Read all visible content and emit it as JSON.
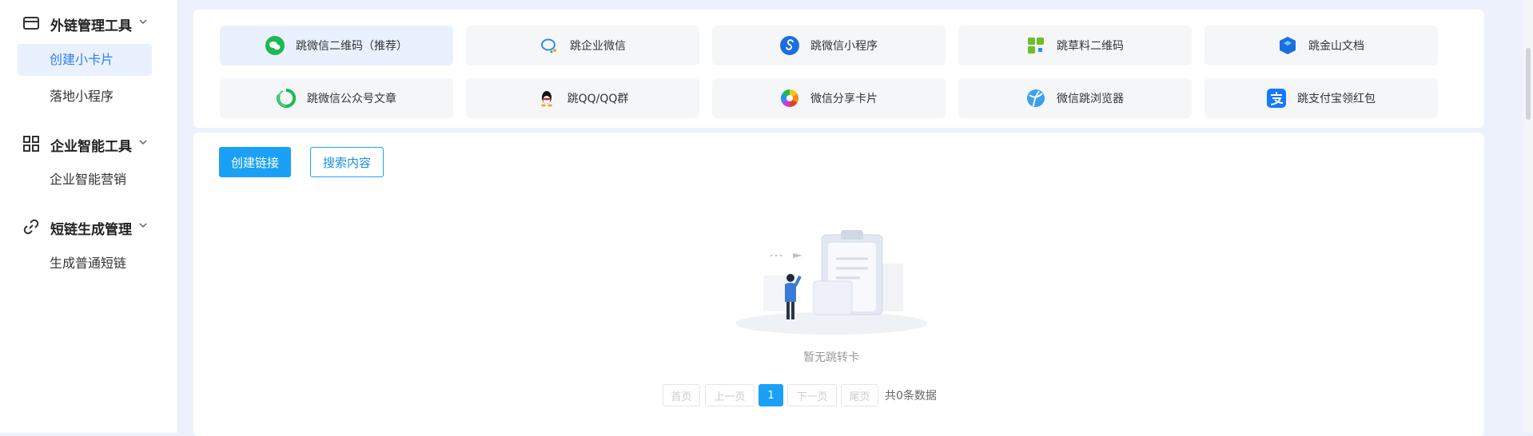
{
  "sidebar": {
    "groups": [
      {
        "label": "外链管理工具",
        "icon": "card-icon",
        "items": [
          "创建小卡片",
          "落地小程序"
        ]
      },
      {
        "label": "企业智能工具",
        "icon": "grid-icon",
        "items": [
          "企业智能营销"
        ]
      },
      {
        "label": "短链生成管理",
        "icon": "link-icon",
        "items": [
          "生成普通短链"
        ]
      }
    ],
    "active_item": "创建小卡片"
  },
  "cards": [
    {
      "label": "跳微信二维码（推荐）",
      "icon": "wechat-icon",
      "active": true
    },
    {
      "label": "跳企业微信",
      "icon": "work-wechat-icon"
    },
    {
      "label": "跳微信小程序",
      "icon": "mini-program-icon"
    },
    {
      "label": "跳草料二维码",
      "icon": "qrcode-icon"
    },
    {
      "label": "跳金山文档",
      "icon": "kingsoft-docs-icon"
    },
    {
      "label": "跳微信公众号文章",
      "icon": "official-account-icon"
    },
    {
      "label": "跳QQ/QQ群",
      "icon": "qq-icon"
    },
    {
      "label": "微信分享卡片",
      "icon": "share-card-icon"
    },
    {
      "label": "微信跳浏览器",
      "icon": "browser-icon"
    },
    {
      "label": "跳支付宝领红包",
      "icon": "alipay-icon"
    }
  ],
  "actions": {
    "create": "创建链接",
    "search": "搜索内容"
  },
  "empty": {
    "text": "暂无跳转卡"
  },
  "pagination": {
    "first": "首页",
    "prev": "上一页",
    "current": "1",
    "next": "下一页",
    "last": "尾页",
    "total": "共0条数据"
  },
  "colors": {
    "primary": "#1aa1f5",
    "active_bg": "#e9f1ff",
    "active_text": "#2d7ff0"
  }
}
